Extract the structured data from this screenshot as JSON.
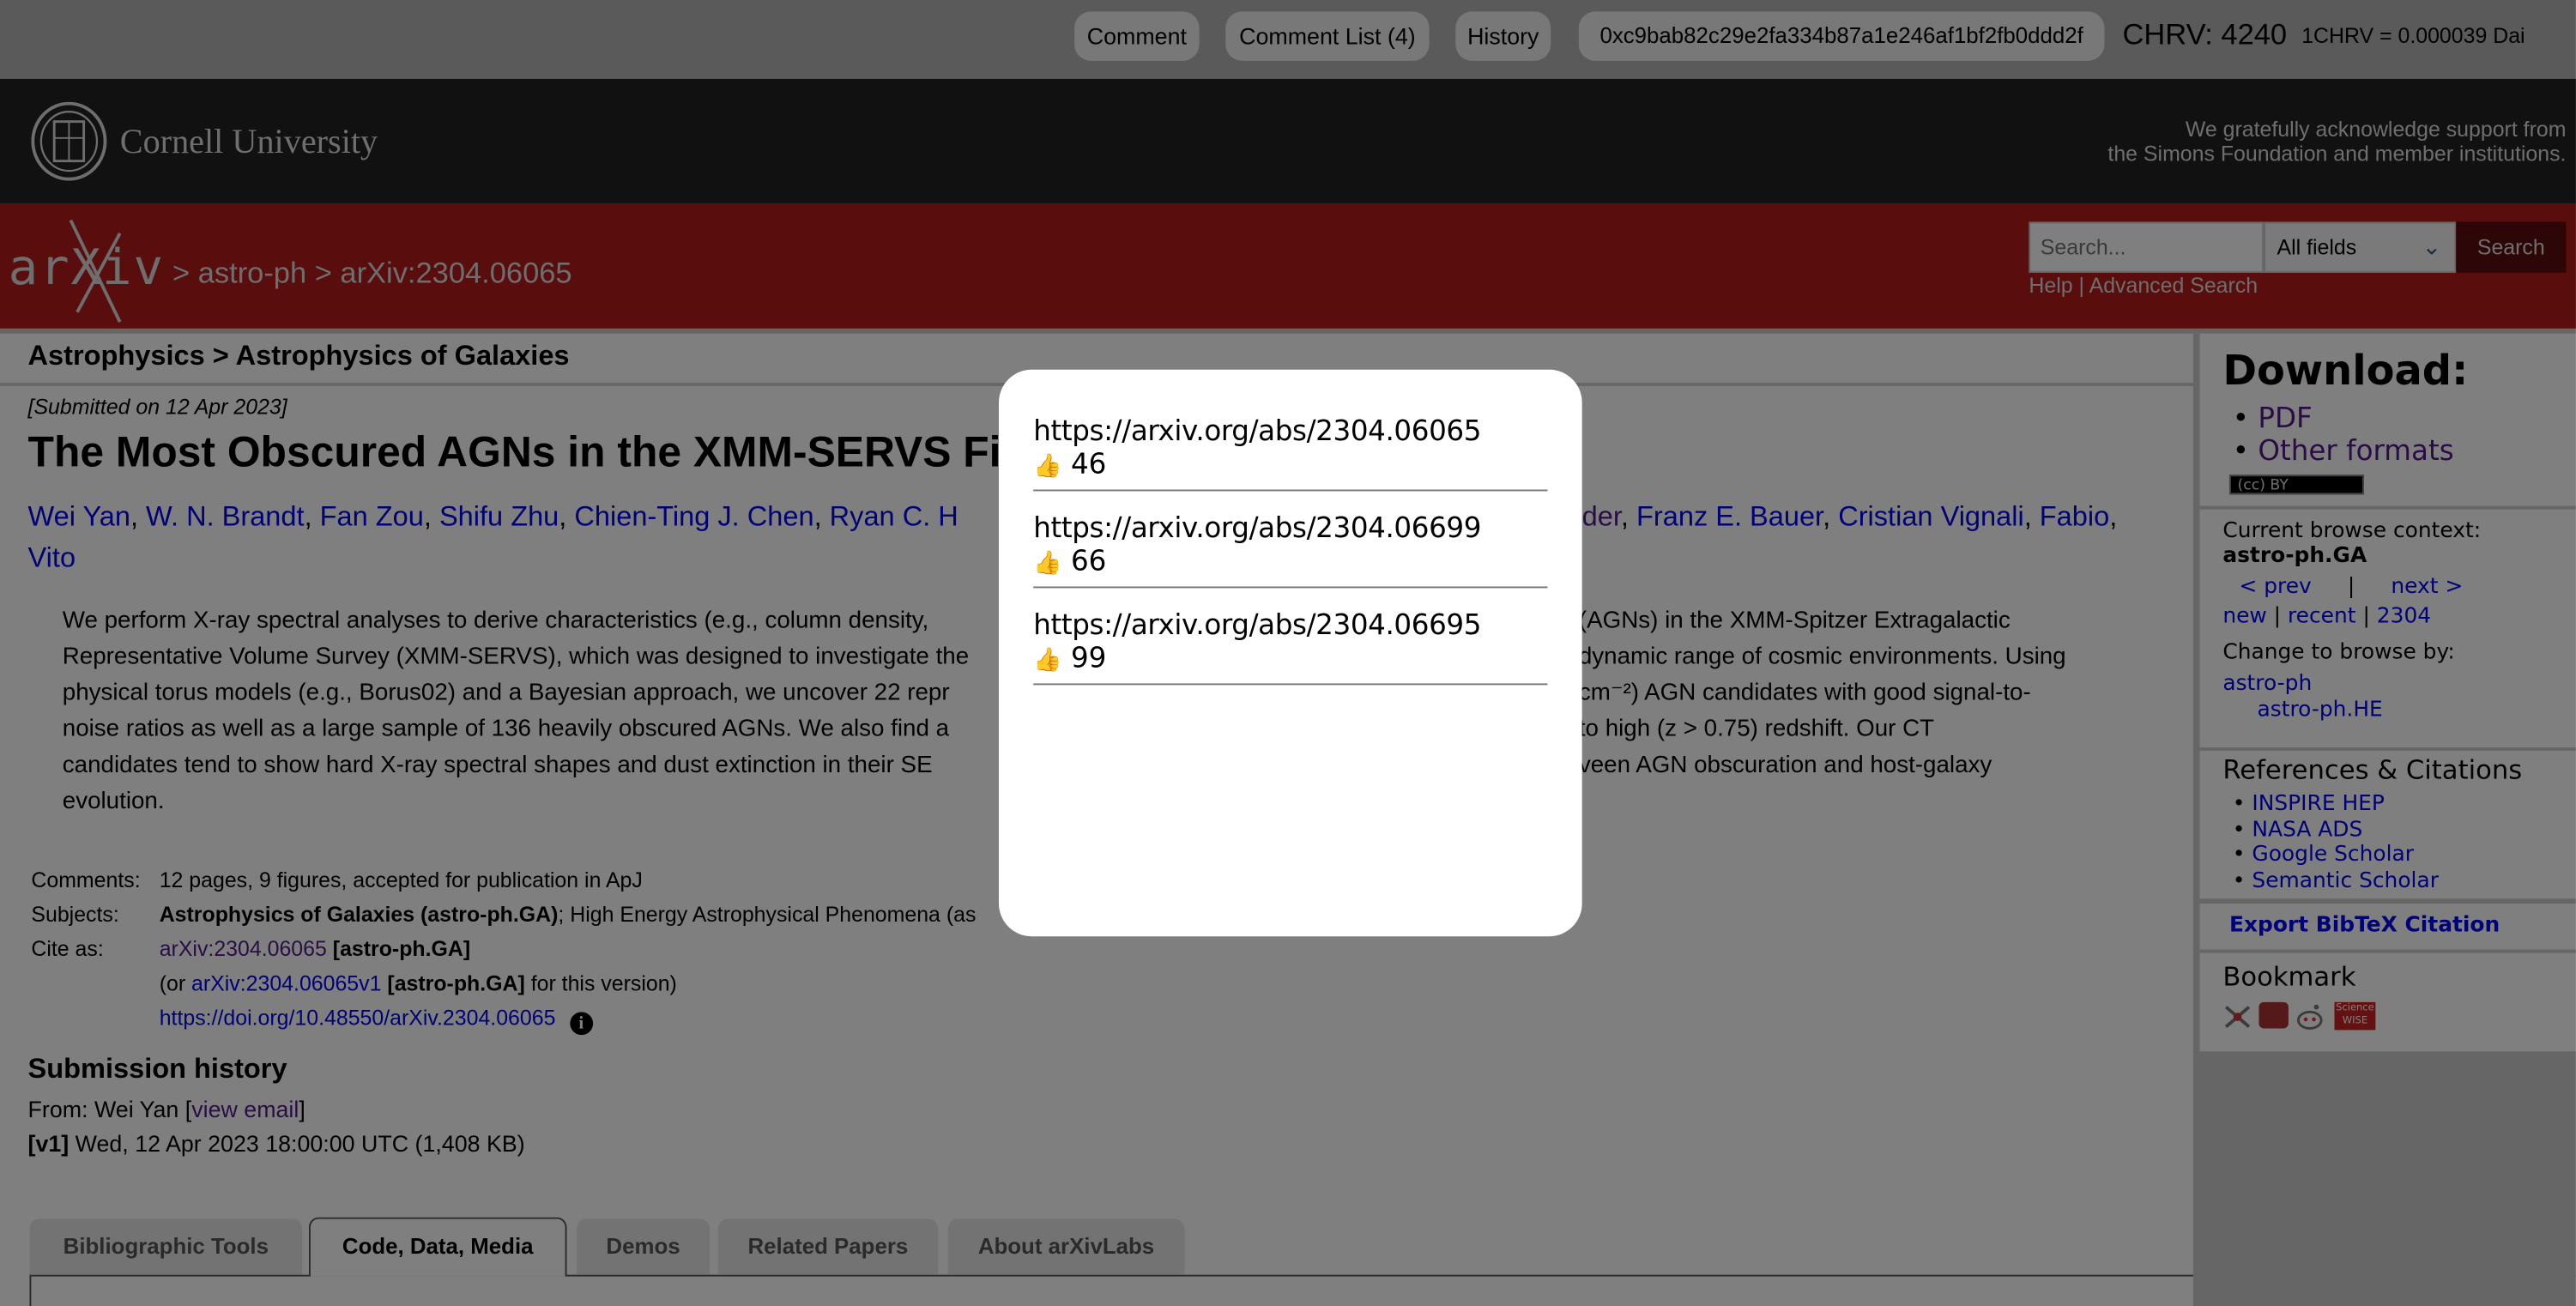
{
  "extension_bar": {
    "comment": "Comment",
    "comment_list": "Comment List (4)",
    "history": "History",
    "wallet_address": "0xc9bab82c29e2fa334b87a1e246af1bf2fb0ddd2f",
    "balance": "CHRV: 4240",
    "rate": "1CHRV = 0.000039 Dai"
  },
  "cornell": {
    "name": "Cornell University",
    "ack_line1": "We gratefully acknowledge support from",
    "ack_line2": "the Simons Foundation and member institutions."
  },
  "arxiv_header": {
    "logo": "arXiv",
    "breadcrumb": "> astro-ph > arXiv:2304.06065",
    "search_placeholder": "Search...",
    "search_field": "All fields",
    "search_button": "Search",
    "help": "Help",
    "sep": "|",
    "advanced": "Advanced Search"
  },
  "category_header": "Astrophysics > Astrophysics of Galaxies",
  "paper": {
    "submitted": "[Submitted on 12 Apr 2023]",
    "title_visible": "The Most Obscured AGNs in the XMM-SERVS Fi",
    "authors_line1_left": [
      "Wei Yan",
      "W. N. Brandt",
      "Fan Zou",
      "Shifu Zhu",
      "Chien-Ting J. Chen",
      "Ryan C. H"
    ],
    "authors_line1_right": [
      "der",
      "Franz E. Bauer",
      "Cristian Vignali",
      "Fabio"
    ],
    "authors_line2": "Vito",
    "abstract_lines": [
      {
        "left": "We perform X-ray spectral analyses to derive characteristics (e.g., column density,",
        "right": "(AGNs) in the XMM-Spitzer Extragalactic"
      },
      {
        "left": "Representative Volume Survey (XMM-SERVS), which was designed to investigate the",
        "right": "dynamic range of cosmic environments. Using"
      },
      {
        "left": "physical torus models (e.g., Borus02) and a Bayesian approach, we uncover 22 repr",
        "right": "cm⁻²) AGN candidates with good signal-to-"
      },
      {
        "left": "noise ratios as well as a large sample of 136 heavily obscured AGNs. We also find a",
        "right": "to high (z > 0.75) redshift. Our CT"
      },
      {
        "left": "candidates tend to show hard X-ray spectral shapes and dust extinction in their SE",
        "right": "veen AGN obscuration and host-galaxy"
      },
      {
        "left": "evolution.",
        "right": ""
      }
    ],
    "meta": {
      "comments_label": "Comments:",
      "comments": "12 pages, 9 figures, accepted for publication in ApJ",
      "subjects_label": "Subjects:",
      "subjects_primary": "Astrophysics of Galaxies (astro-ph.GA)",
      "subjects_rest": "; High Energy Astrophysical Phenomena (as",
      "cite_label": "Cite as:",
      "cite_id": "arXiv:2304.06065",
      "cite_cat": "[astro-ph.GA]",
      "version_prefix": "(or ",
      "version_id": "arXiv:2304.06065v1",
      "version_cat": "[astro-ph.GA]",
      "version_suffix": " for this version)",
      "doi": "https://doi.org/10.48550/arXiv.2304.06065"
    },
    "history": {
      "heading": "Submission history",
      "from_prefix": "From: Wei Yan [",
      "view_email": "view email",
      "from_suffix": "]",
      "v1_label": "[v1]",
      "v1_text": " Wed, 12 Apr 2023 18:00:00 UTC (1,408 KB)"
    }
  },
  "tabs": [
    {
      "label": "Bibliographic Tools",
      "active": false
    },
    {
      "label": "Code, Data, Media",
      "active": true
    },
    {
      "label": "Demos",
      "active": false
    },
    {
      "label": "Related Papers",
      "active": false
    },
    {
      "label": "About arXivLabs",
      "active": false
    }
  ],
  "sidebar": {
    "download_heading": "Download:",
    "pdf": "PDF",
    "other_formats": "Other formats",
    "license": "(cc) BY",
    "browse_context_label": "Current browse context:",
    "browse_context": "astro-ph.GA",
    "prev": "< prev",
    "bar": "|",
    "next": "next >",
    "new": "new",
    "recent": "recent",
    "month": "2304",
    "change_browse": "Change to browse by:",
    "browse_astro_ph": "astro-ph",
    "browse_astro_ph_he": "astro-ph.HE",
    "refs_heading": "References & Citations",
    "refs": [
      "INSPIRE HEP",
      "NASA ADS",
      "Google Scholar",
      "Semantic Scholar"
    ],
    "export_bibtex": "Export BibTeX Citation",
    "bookmark_heading": "Bookmark",
    "bookmark_icons": [
      "bibsonomy-icon",
      "mendeley-icon",
      "reddit-icon",
      "sciencewise-icon"
    ],
    "sciencewise_text": "Science WISE"
  },
  "modal": {
    "entries": [
      {
        "url": "https://arxiv.org/abs/2304.06065",
        "likes": "46"
      },
      {
        "url": "https://arxiv.org/abs/2304.06699",
        "likes": "66"
      },
      {
        "url": "https://arxiv.org/abs/2304.06695",
        "likes": "99"
      }
    ],
    "like_icon": "👍"
  },
  "colors": {
    "arxiv_red": "#b31b1b",
    "cornell_black": "#222222",
    "link": "#0000ee",
    "visited_link": "#551a8b",
    "overlay": "rgba(0,0,0,0.5)"
  }
}
